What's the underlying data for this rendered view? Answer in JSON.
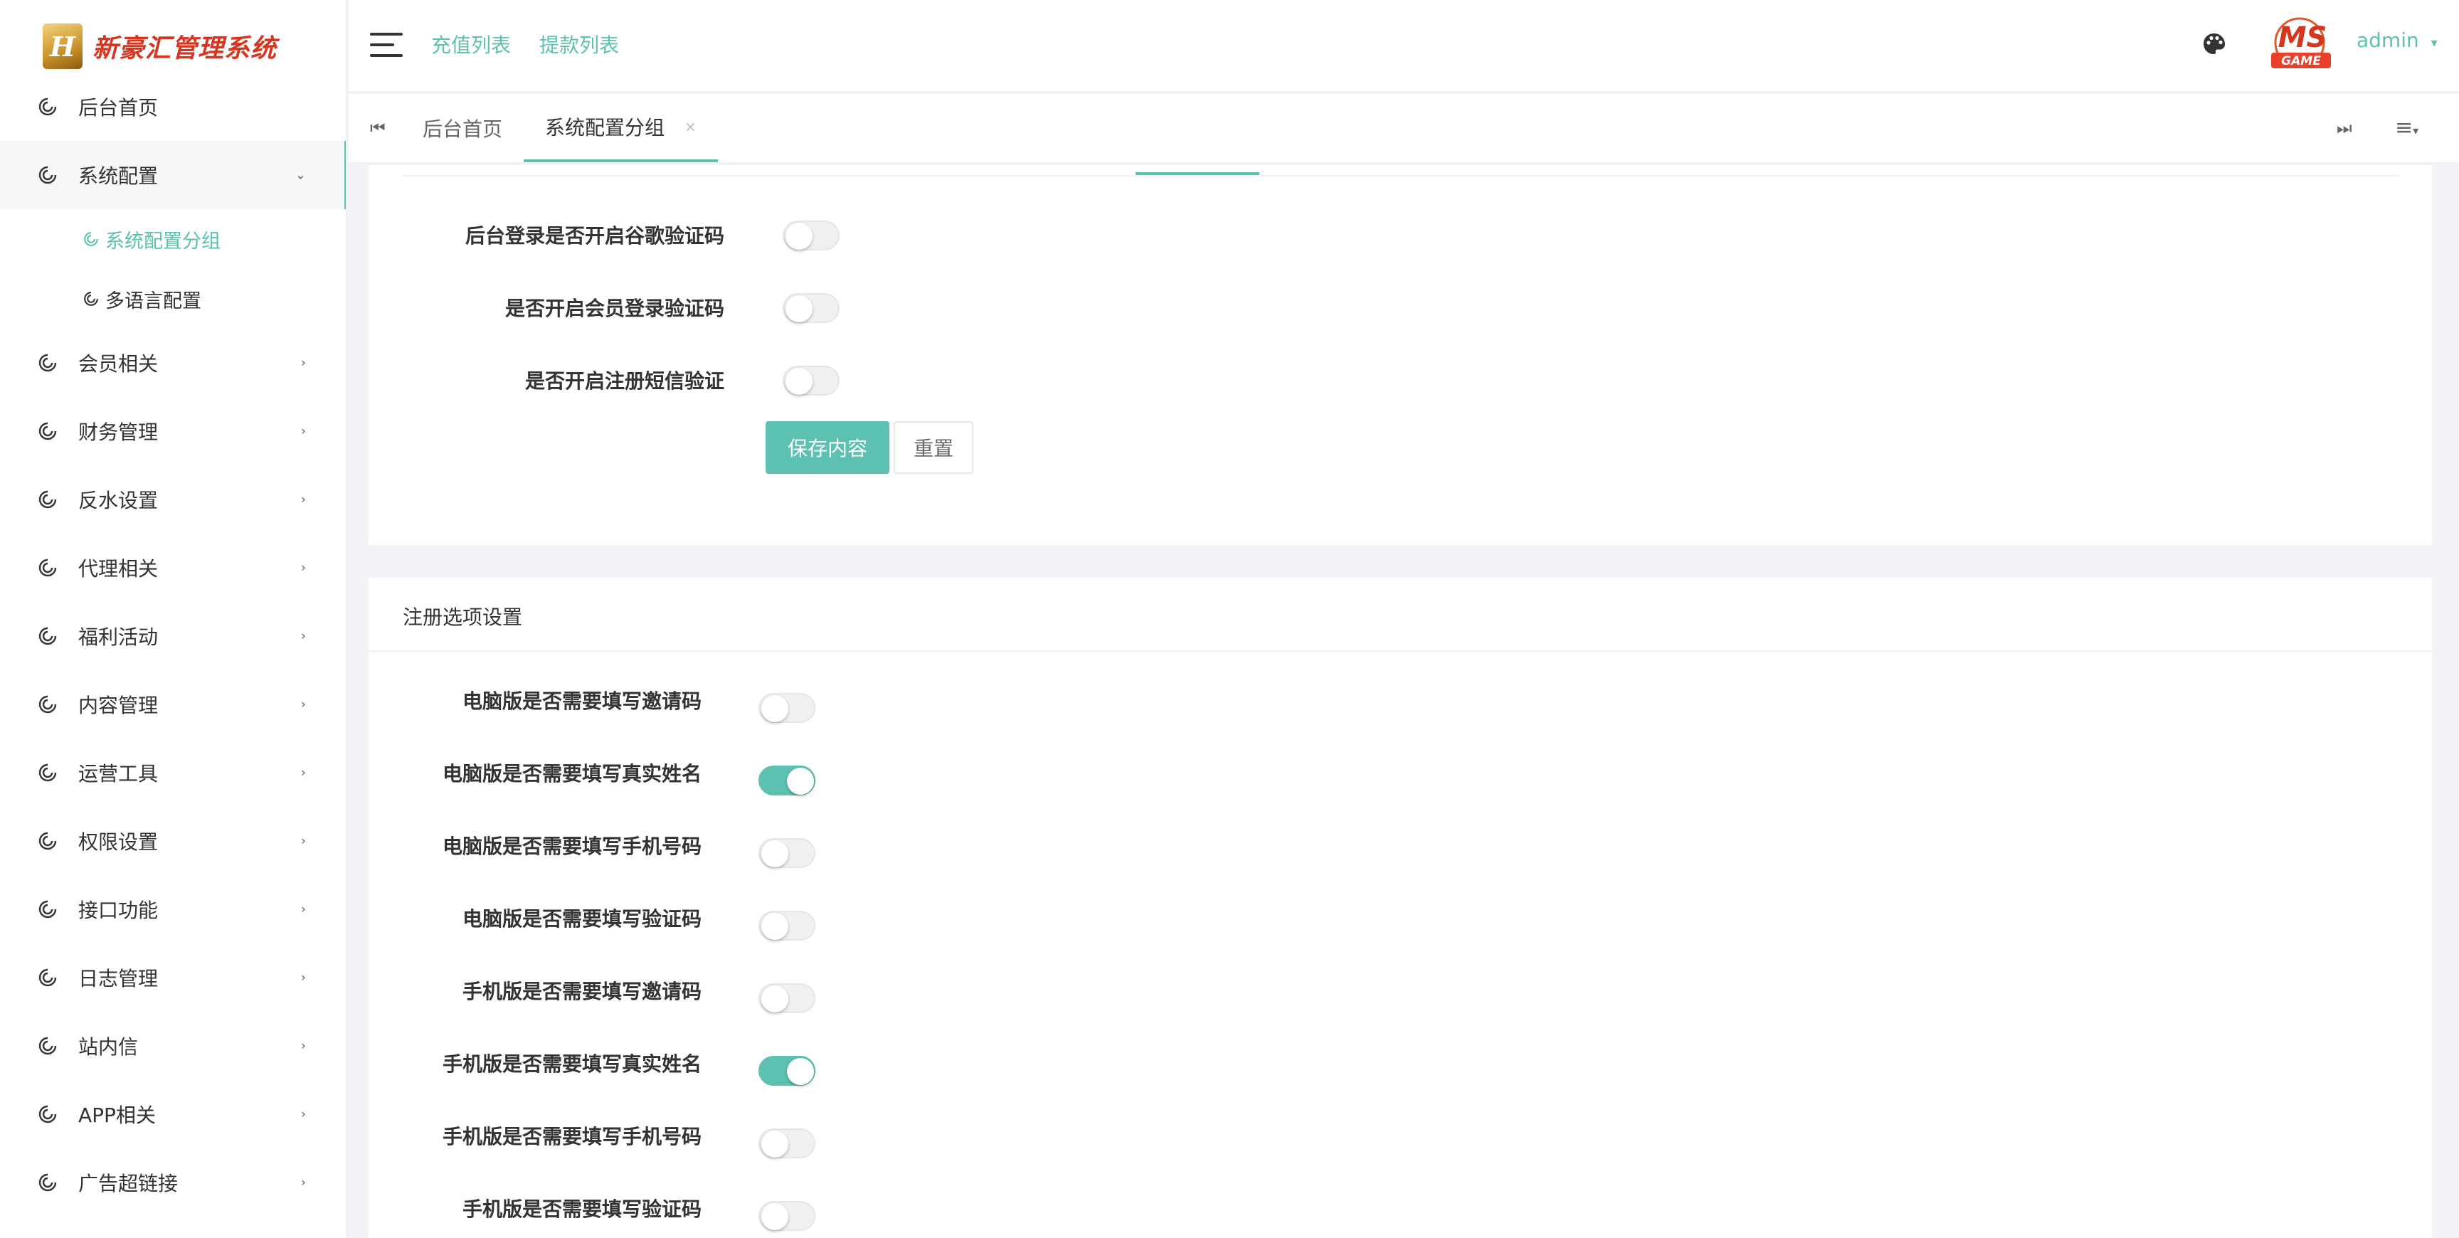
{
  "app": {
    "logo_text": "新豪汇管理系统"
  },
  "sidebar": {
    "items": [
      {
        "label": "后台首页"
      },
      {
        "label": "系统配置"
      },
      {
        "label": "会员相关"
      },
      {
        "label": "财务管理"
      },
      {
        "label": "反水设置"
      },
      {
        "label": "代理相关"
      },
      {
        "label": "福利活动"
      },
      {
        "label": "内容管理"
      },
      {
        "label": "运营工具"
      },
      {
        "label": "权限设置"
      },
      {
        "label": "接口功能"
      },
      {
        "label": "日志管理"
      },
      {
        "label": "站内信"
      },
      {
        "label": "APP相关"
      },
      {
        "label": "广告超链接"
      }
    ],
    "submenu": [
      {
        "label": "系统配置分组",
        "active": true
      },
      {
        "label": "多语言配置",
        "active": false
      }
    ]
  },
  "header": {
    "links": [
      "充值列表",
      "提款列表"
    ],
    "user": "admin",
    "brand_badge": "MS GAME"
  },
  "tabs": {
    "items": [
      {
        "label": "后台首页"
      },
      {
        "label": "系统配置分组",
        "close": "×"
      }
    ]
  },
  "section1": {
    "fields": [
      {
        "label": "后台登录是否开启谷歌验证码",
        "on": false
      },
      {
        "label": "是否开启会员登录验证码",
        "on": false
      },
      {
        "label": "是否开启注册短信验证",
        "on": false
      }
    ],
    "save_label": "保存内容",
    "reset_label": "重置"
  },
  "section2": {
    "title": "注册选项设置",
    "fields": [
      {
        "label": "电脑版是否需要填写邀请码",
        "on": false
      },
      {
        "label": "电脑版是否需要填写真实姓名",
        "on": true
      },
      {
        "label": "电脑版是否需要填写手机号码",
        "on": false
      },
      {
        "label": "电脑版是否需要填写验证码",
        "on": false
      },
      {
        "label": "手机版是否需要填写邀请码",
        "on": false
      },
      {
        "label": "手机版是否需要填写真实姓名",
        "on": true
      },
      {
        "label": "手机版是否需要填写手机号码",
        "on": false
      },
      {
        "label": "手机版是否需要填写验证码",
        "on": false
      }
    ]
  },
  "colors": {
    "accent": "#5cc1b0",
    "logo_red": "#d6351f",
    "background": "#f2f3f7"
  }
}
